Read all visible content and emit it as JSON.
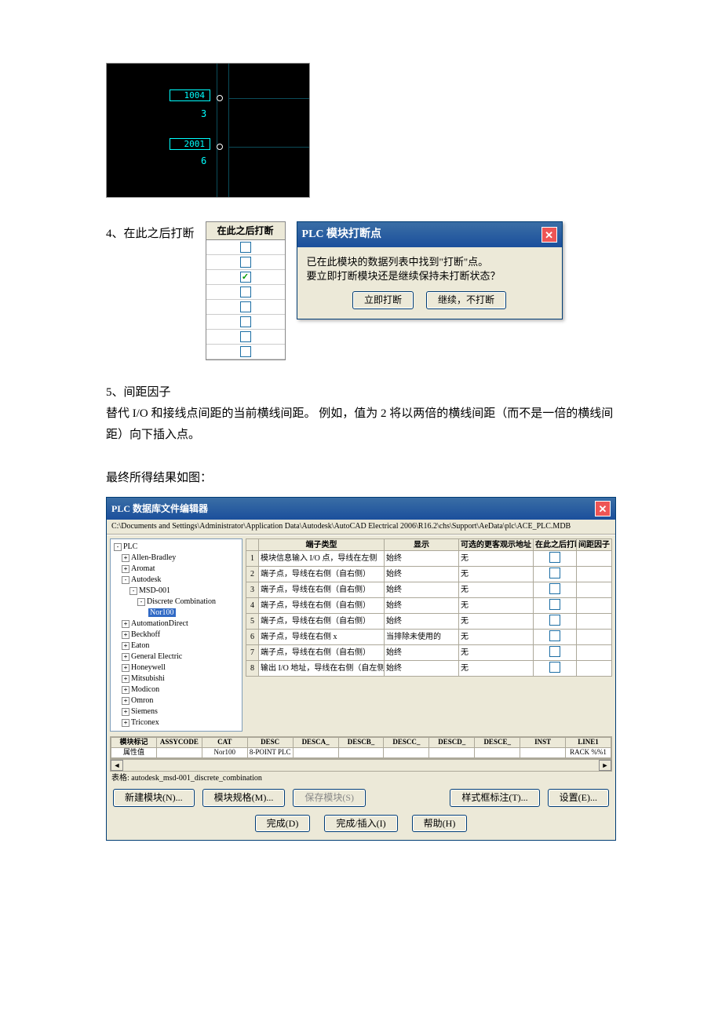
{
  "cad": {
    "wire1": "1004",
    "wire2": "2001",
    "num1": "3",
    "num2": "6"
  },
  "section4": {
    "label": "4、在此之后打断",
    "header": "在此之后打断",
    "checks": [
      false,
      false,
      true,
      false,
      false,
      false,
      false,
      false
    ]
  },
  "dialog": {
    "title": "PLC 模块打断点",
    "msg1": "已在此模块的数据列表中找到\"打断\"点。",
    "msg2": "要立即打断模块还是继续保持未打断状态？",
    "btn1": "立即打断",
    "btn2": "继续，不打断"
  },
  "section5": {
    "label": "5、间距因子",
    "text": "替代 I/O 和接线点间距的当前横线间距。 例如，值为 2 将以两倍的横线间距（而不是一倍的横线间距）向下插入点。"
  },
  "final": "最终所得结果如图：",
  "editor": {
    "title": "PLC 数据库文件编辑器",
    "path": "C:\\Documents and Settings\\Administrator\\Application Data\\Autodesk\\AutoCAD Electrical 2006\\R16.2\\chs\\Support\\AeData\\plc\\ACE_PLC.MDB",
    "tree": {
      "root": "PLC",
      "items": [
        "Allen-Bradley",
        "Aromat",
        "Autodesk"
      ],
      "autodesk_child": "MSD-001",
      "msd_child": "Discrete Combination",
      "selected": "Nor100",
      "rest": [
        "AutomationDirect",
        "Beckhoff",
        "Eaton",
        "General Electric",
        "Honeywell",
        "Mitsubishi",
        "Modicon",
        "Omron",
        "Siemens",
        "Triconex"
      ]
    },
    "grid": {
      "headers": [
        " ",
        "端子类型",
        "显示",
        "可选的更客观示地址",
        "在此之后打断",
        "间距因子"
      ],
      "rows": [
        [
          "1",
          "模块信息输入 I/O 点，导线在左侧",
          "始终",
          "无",
          false,
          ""
        ],
        [
          "2",
          "端子点，导线在右侧（自右侧）",
          "始终",
          "无",
          false,
          ""
        ],
        [
          "3",
          "端子点，导线在右侧（自右侧）",
          "始终",
          "无",
          false,
          ""
        ],
        [
          "4",
          "端子点，导线在右侧（自右侧）",
          "始终",
          "无",
          false,
          ""
        ],
        [
          "5",
          "端子点，导线在右侧（自右侧）",
          "始终",
          "无",
          false,
          ""
        ],
        [
          "6",
          "端子点，导线在右侧 x",
          "当排除未使用的",
          "无",
          false,
          ""
        ],
        [
          "7",
          "端子点，导线在右侧（自右侧）",
          "始终",
          "无",
          false,
          ""
        ],
        [
          "8",
          "输出 I/O 地址，导线在右侧（自左侧）",
          "始终",
          "无",
          false,
          ""
        ]
      ]
    },
    "attrs": {
      "headers": [
        "模块标记",
        "ASSYCODE",
        "CAT",
        "DESC",
        "DESCA_",
        "DESCB_",
        "DESCC_",
        "DESCD_",
        "DESCE_",
        "INST",
        "LINE1"
      ],
      "row": [
        "属性值",
        "",
        "Nor100",
        "8-POINT PLC",
        "",
        "",
        "",
        "",
        "",
        "",
        "RACK %%1"
      ]
    },
    "table_label": "表格: autodesk_msd-001_discrete_combination",
    "btns": {
      "new": "新建模块(N)...",
      "spec": "模块规格(M)...",
      "save": "保存模块(S)",
      "style": "样式框标注(T)...",
      "settings": "设置(E)...",
      "done": "完成(D)",
      "doneins": "完成/插入(I)",
      "help": "帮助(H)"
    }
  }
}
